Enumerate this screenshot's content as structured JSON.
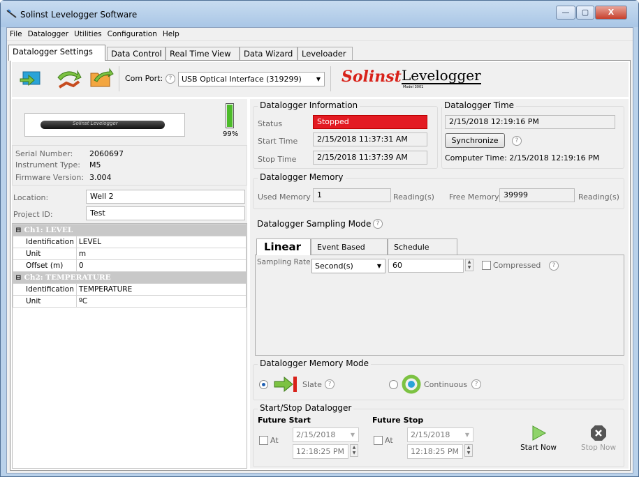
{
  "window": {
    "title": "Solinst Levelogger Software",
    "minimize": "—",
    "maximize": "▢",
    "close": "X"
  },
  "menu": [
    "File",
    "Datalogger",
    "Utilities",
    "Configuration",
    "Help"
  ],
  "tabs": [
    "Datalogger Settings",
    "Data Control",
    "Real Time View",
    "Data Wizard",
    "Leveloader"
  ],
  "toolbar": {
    "com_port_label": "Com Port:",
    "com_port_value": "USB Optical Interface (319299)",
    "brand_solinst": "Solinst",
    "brand_levelogger": "Levelogger",
    "brand_model": "Model 3001"
  },
  "device": {
    "image_label": "Solinst Levelogger",
    "battery": "99%",
    "battery_level": 0.99,
    "serial_label": "Serial Number:",
    "serial": "2060697",
    "instrument_label": "Instrument Type:",
    "instrument": "M5",
    "firmware_label": "Firmware Version:",
    "firmware": "3.004",
    "location_label": "Location:",
    "location": "Well 2",
    "project_label": "Project ID:",
    "project": "Test"
  },
  "channels": [
    {
      "title": "Ch1: LEVEL",
      "rows": [
        [
          "Identification",
          "LEVEL"
        ],
        [
          "Unit",
          "m"
        ],
        [
          "Offset (m)",
          "0"
        ]
      ]
    },
    {
      "title": "Ch2: TEMPERATURE",
      "rows": [
        [
          "Identification",
          "TEMPERATURE"
        ],
        [
          "Unit",
          "ºC"
        ]
      ]
    }
  ],
  "info": {
    "title": "Datalogger Information",
    "status_label": "Status",
    "status": "Stopped",
    "start_label": "Start Time",
    "start": "2/15/2018 11:37:31 AM",
    "stop_label": "Stop Time",
    "stop": "2/15/2018 11:37:39 AM"
  },
  "time": {
    "title": "Datalogger Time",
    "value": "2/15/2018 12:19:16 PM",
    "sync": "Synchronize",
    "computer": "Computer Time: 2/15/2018 12:19:16 PM"
  },
  "memory": {
    "title": "Datalogger Memory",
    "used_label": "Used Memory",
    "used": "1",
    "used_unit": "Reading(s)",
    "free_label": "Free Memory",
    "free": "39999",
    "free_unit": "Reading(s)"
  },
  "sampling": {
    "title": "Datalogger Sampling Mode",
    "tabs": [
      "Linear",
      "Event Based",
      "Schedule"
    ],
    "rate_label": "Sampling Rate",
    "rate_unit": "Second(s)",
    "rate_value": "60",
    "compressed": "Compressed"
  },
  "memmode": {
    "title": "Datalogger Memory Mode",
    "slate": "Slate",
    "continuous": "Continuous"
  },
  "startstop": {
    "title": "Start/Stop Datalogger",
    "future_start": "Future Start",
    "future_stop": "Future Stop",
    "at": "At",
    "start_date": "2/15/2018",
    "start_time": "12:18:25 PM",
    "stop_date": "2/15/2018",
    "stop_time": "12:18:25 PM",
    "start_now": "Start Now",
    "stop_now": "Stop Now"
  }
}
